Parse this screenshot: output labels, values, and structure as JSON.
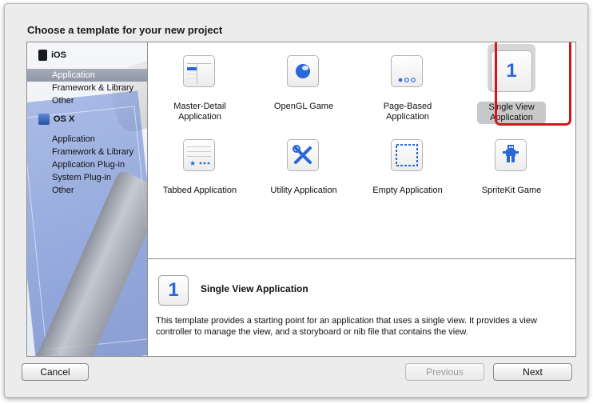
{
  "dialog": {
    "title": "Choose a template for your new project"
  },
  "sidebar": {
    "ios": {
      "label": "iOS",
      "items": [
        {
          "label": "Application",
          "selected": true
        },
        {
          "label": "Framework & Library"
        },
        {
          "label": "Other"
        }
      ]
    },
    "osx": {
      "label": "OS X",
      "items": [
        {
          "label": "Application"
        },
        {
          "label": "Framework & Library"
        },
        {
          "label": "Application Plug-in"
        },
        {
          "label": "System Plug-in"
        },
        {
          "label": "Other"
        }
      ]
    }
  },
  "templates": [
    {
      "name": "Master-Detail\nApplication",
      "icon": "master-detail-icon"
    },
    {
      "name": "OpenGL Game",
      "icon": "opengl-icon"
    },
    {
      "name": "Page-Based\nApplication",
      "icon": "page-based-icon"
    },
    {
      "name": "Single View\nApplication",
      "icon": "single-view-icon",
      "glyph": "1",
      "selected": true
    },
    {
      "name": "Tabbed Application",
      "icon": "tabbed-icon"
    },
    {
      "name": "Utility Application",
      "icon": "utility-icon"
    },
    {
      "name": "Empty Application",
      "icon": "empty-icon"
    },
    {
      "name": "SpriteKit Game",
      "icon": "spritekit-icon"
    }
  ],
  "description": {
    "icon_glyph": "1",
    "title": "Single View Application",
    "text": "This template provides a starting point for an application that uses a single view. It provides a view controller to manage the view, and a storyboard or nib file that contains the view."
  },
  "buttons": {
    "cancel": "Cancel",
    "previous": "Previous",
    "next": "Next"
  },
  "colors": {
    "accent": "#2a67d8",
    "selection_highlight": "#d9131b"
  }
}
